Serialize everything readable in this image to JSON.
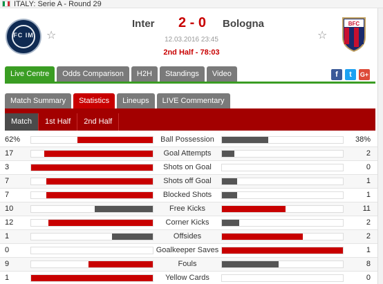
{
  "breadcrumb": "ITALY: Serie A - Round 29",
  "flag_colors": [
    "#009246",
    "#ffffff",
    "#ce2b37"
  ],
  "match": {
    "home_team": "Inter",
    "away_team": "Bologna",
    "score": "2 - 0",
    "datetime": "12.03.2016 23:45",
    "status": "2nd Half - 78:03",
    "home_logo_text": "FC IM",
    "away_logo_text": "BFC"
  },
  "main_tabs": [
    {
      "label": "Live Centre",
      "active": true
    },
    {
      "label": "Odds Comparison",
      "active": false
    },
    {
      "label": "H2H",
      "active": false
    },
    {
      "label": "Standings",
      "active": false
    },
    {
      "label": "Video",
      "active": false
    }
  ],
  "social": {
    "facebook": "f",
    "twitter": "t",
    "google": "G+"
  },
  "sub_tabs": [
    {
      "label": "Match Summary",
      "active": false
    },
    {
      "label": "Statistics",
      "active": true
    },
    {
      "label": "Lineups",
      "active": false
    },
    {
      "label": "LIVE Commentary",
      "active": false
    }
  ],
  "period_tabs": [
    {
      "label": "Match",
      "active": true
    },
    {
      "label": "1st Half",
      "active": false
    },
    {
      "label": "2nd Half",
      "active": false
    }
  ],
  "colors": {
    "accent_green": "#3a9d23",
    "accent_red": "#c80000",
    "bar_leader": "#c80000",
    "bar_trailer": "#555555"
  },
  "stats": [
    {
      "label": "Ball Possession",
      "home": "62%",
      "away": "38%",
      "hv": 62,
      "av": 38
    },
    {
      "label": "Goal Attempts",
      "home": "17",
      "away": "2",
      "hv": 17,
      "av": 2
    },
    {
      "label": "Shots on Goal",
      "home": "3",
      "away": "0",
      "hv": 3,
      "av": 0
    },
    {
      "label": "Shots off Goal",
      "home": "7",
      "away": "1",
      "hv": 7,
      "av": 1
    },
    {
      "label": "Blocked Shots",
      "home": "7",
      "away": "1",
      "hv": 7,
      "av": 1
    },
    {
      "label": "Free Kicks",
      "home": "10",
      "away": "11",
      "hv": 10,
      "av": 11
    },
    {
      "label": "Corner Kicks",
      "home": "12",
      "away": "2",
      "hv": 12,
      "av": 2
    },
    {
      "label": "Offsides",
      "home": "1",
      "away": "2",
      "hv": 1,
      "av": 2
    },
    {
      "label": "Goalkeeper Saves",
      "home": "0",
      "away": "1",
      "hv": 0,
      "av": 1
    },
    {
      "label": "Fouls",
      "home": "9",
      "away": "8",
      "hv": 9,
      "av": 8
    },
    {
      "label": "Yellow Cards",
      "home": "1",
      "away": "0",
      "hv": 1,
      "av": 0
    }
  ]
}
